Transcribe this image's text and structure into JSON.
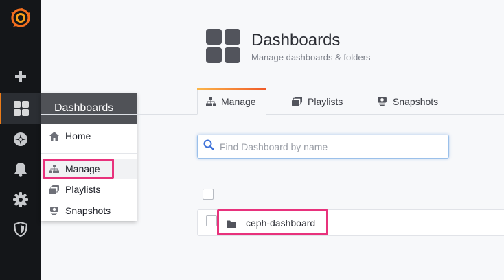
{
  "sidebar": {
    "icons": [
      "grafana-logo-icon",
      "plus-icon",
      "dashboards-grid-icon",
      "explore-compass-icon",
      "bell-icon",
      "gear-icon",
      "shield-icon"
    ],
    "accent": "#eb7b18"
  },
  "flyout": {
    "title": "Dashboards",
    "items": [
      {
        "label": "Home",
        "icon": "home-icon"
      },
      {
        "label": "Manage",
        "icon": "sitemap-icon"
      },
      {
        "label": "Playlists",
        "icon": "playlists-icon"
      },
      {
        "label": "Snapshots",
        "icon": "snapshots-icon"
      }
    ]
  },
  "header": {
    "title": "Dashboards",
    "subtitle": "Manage dashboards & folders"
  },
  "tabs": [
    {
      "label": "Manage",
      "icon": "sitemap-icon",
      "active": true
    },
    {
      "label": "Playlists",
      "icon": "playlists-icon",
      "active": false
    },
    {
      "label": "Snapshots",
      "icon": "snapshots-icon",
      "active": false
    }
  ],
  "search": {
    "placeholder": "Find Dashboard by name",
    "value": ""
  },
  "list": {
    "folders": [
      {
        "name": "ceph-dashboard",
        "icon": "folder-icon"
      }
    ]
  },
  "colors": {
    "highlight": "#e8327c",
    "sidebar_bg": "#141619",
    "tab_gradient_start": "#fbb64a",
    "tab_gradient_end": "#f05a28"
  }
}
